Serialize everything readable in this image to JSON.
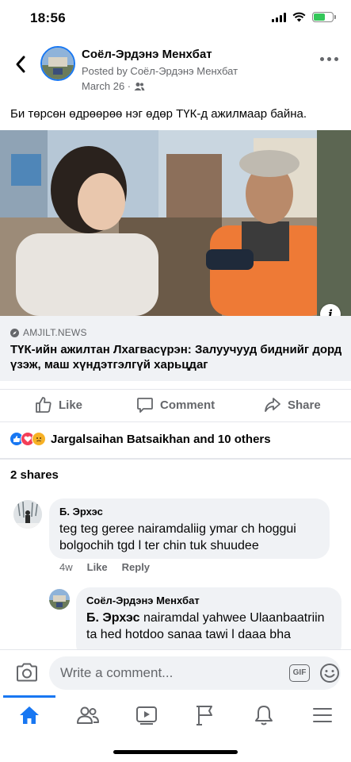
{
  "status": {
    "time": "18:56"
  },
  "post": {
    "author": "Соёл-Эрдэнэ Менхбат",
    "posted_by": "Posted by Соёл-Эрдэнэ Менхбат",
    "date": "March 26 ·",
    "text": "Би төрсөн өдрөөрөө нэг өдөр ТҮК-д ажилмаар байна."
  },
  "link": {
    "domain": "AMJILT.NEWS",
    "title": "ТҮК-ийн ажилтан Лхагвасүрэн: Залуучууд биднийг дорд үзэж, маш хүндэтгэлгүй харьцдаг",
    "info_glyph": "i"
  },
  "actions": {
    "like": "Like",
    "comment": "Comment",
    "share": "Share"
  },
  "reactions": {
    "summary": "Jargalsaihan Batsaikhan and 10 others"
  },
  "shares": "2 shares",
  "comments": [
    {
      "author": "Б. Эрхэс",
      "text": "teg teg geree nairamdaliig ymar ch hoggui bolgochih tgd l ter chin tuk shuudee",
      "time": "4w",
      "like": "Like",
      "reply": "Reply"
    },
    {
      "author": "Соёл-Эрдэнэ Менхбат",
      "mention": "Б. Эрхэс",
      "text": " nairamdal yahwee Ulaanbaatriin ta hed hotdoo sanaa tawi l daaa bha"
    }
  ],
  "composer": {
    "placeholder": "Write a comment...",
    "gif": "GIF"
  },
  "tabs": [
    "home-icon",
    "friends-icon",
    "watch-icon",
    "pages-icon",
    "notifications-icon",
    "menu-icon"
  ],
  "colors": {
    "accent": "#1877f2",
    "secondary_text": "#65676b",
    "bubble": "#f0f2f5",
    "like_blue": "#1877f2",
    "love_red": "#f33e58",
    "sad_yellow": "#f7b125"
  }
}
